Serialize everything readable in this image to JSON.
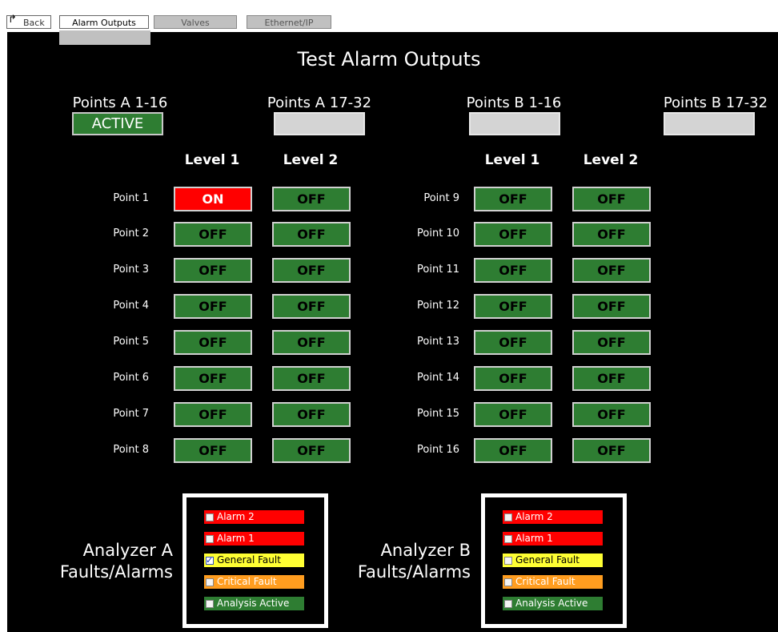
{
  "nav": {
    "back_label": "Back",
    "tabs": [
      {
        "label": "Alarm Outputs",
        "active": true
      },
      {
        "label": "Valves",
        "active": false
      },
      {
        "label": "Ethernet/IP",
        "active": false
      }
    ]
  },
  "title": "Test Alarm Outputs",
  "groups": [
    {
      "label": "Points A 1-16",
      "status": "ACTIVE"
    },
    {
      "label": "Points A 17-32",
      "status": ""
    },
    {
      "label": "Points B 1-16",
      "status": ""
    },
    {
      "label": "Points B 17-32",
      "status": ""
    }
  ],
  "level_headers": {
    "level1": "Level 1",
    "level2": "Level 2"
  },
  "points_left": [
    {
      "name": "Point 1",
      "level1": "ON",
      "level2": "OFF"
    },
    {
      "name": "Point 2",
      "level1": "OFF",
      "level2": "OFF"
    },
    {
      "name": "Point 3",
      "level1": "OFF",
      "level2": "OFF"
    },
    {
      "name": "Point 4",
      "level1": "OFF",
      "level2": "OFF"
    },
    {
      "name": "Point 5",
      "level1": "OFF",
      "level2": "OFF"
    },
    {
      "name": "Point 6",
      "level1": "OFF",
      "level2": "OFF"
    },
    {
      "name": "Point 7",
      "level1": "OFF",
      "level2": "OFF"
    },
    {
      "name": "Point 8",
      "level1": "OFF",
      "level2": "OFF"
    }
  ],
  "points_right": [
    {
      "name": "Point 9",
      "level1": "OFF",
      "level2": "OFF"
    },
    {
      "name": "Point 10",
      "level1": "OFF",
      "level2": "OFF"
    },
    {
      "name": "Point 11",
      "level1": "OFF",
      "level2": "OFF"
    },
    {
      "name": "Point 12",
      "level1": "OFF",
      "level2": "OFF"
    },
    {
      "name": "Point 13",
      "level1": "OFF",
      "level2": "OFF"
    },
    {
      "name": "Point 14",
      "level1": "OFF",
      "level2": "OFF"
    },
    {
      "name": "Point 15",
      "level1": "OFF",
      "level2": "OFF"
    },
    {
      "name": "Point 16",
      "level1": "OFF",
      "level2": "OFF"
    }
  ],
  "analyzers": [
    {
      "label_line1": "Analyzer A",
      "label_line2": "Faults/Alarms",
      "faults": [
        {
          "label": "Alarm 2",
          "color": "red",
          "checked": false
        },
        {
          "label": "Alarm 1",
          "color": "red",
          "checked": false
        },
        {
          "label": "General Fault",
          "color": "yellow",
          "checked": true
        },
        {
          "label": "Critical Fault",
          "color": "orange",
          "checked": false
        },
        {
          "label": "Analysis Active",
          "color": "green",
          "checked": false
        }
      ]
    },
    {
      "label_line1": "Analyzer B",
      "label_line2": "Faults/Alarms",
      "faults": [
        {
          "label": "Alarm 2",
          "color": "red",
          "checked": false
        },
        {
          "label": "Alarm 1",
          "color": "red",
          "checked": false
        },
        {
          "label": "General Fault",
          "color": "yellow",
          "checked": false
        },
        {
          "label": "Critical Fault",
          "color": "orange",
          "checked": false
        },
        {
          "label": "Analysis Active",
          "color": "green",
          "checked": false
        }
      ]
    }
  ],
  "colors": {
    "on": "#ff0000",
    "off": "#2e7d32",
    "fault_red": "#ff0000",
    "fault_yellow": "#ffff33",
    "fault_orange": "#ff9d1f",
    "fault_green": "#2e7d32"
  }
}
